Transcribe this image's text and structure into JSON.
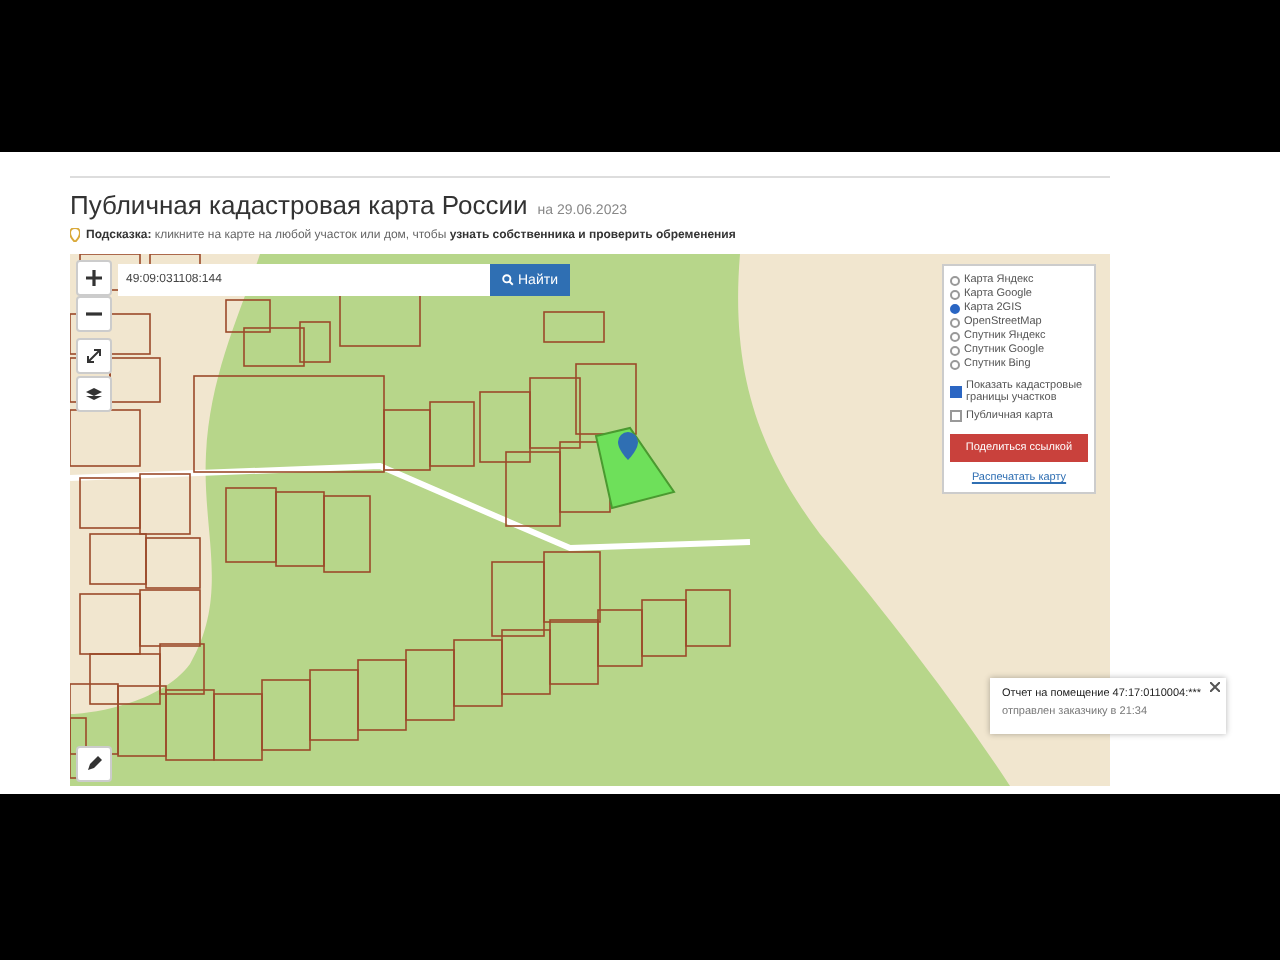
{
  "header": {
    "title": "Публичная кадастровая карта России",
    "date": "на 29.06.2023"
  },
  "hint": "**Подсказка:** кликните на карте на любой участок или дом, чтобы **узнать собственника и проверить обременения**",
  "search": {
    "value": "49:09:031108:144",
    "button": "Найти"
  },
  "layers": [
    {
      "label": "Карта Яндекс",
      "selected": false
    },
    {
      "label": "Карта Google",
      "selected": false
    },
    {
      "label": "Карта 2GIS",
      "selected": true
    },
    {
      "label": "OpenStreetMap",
      "selected": false
    },
    {
      "label": "Спутник Яндекс",
      "selected": false
    },
    {
      "label": "Спутник Google",
      "selected": false
    },
    {
      "label": "Спутник Bing",
      "selected": false
    }
  ],
  "options": [
    {
      "label": "Показать кадастровые границы участков",
      "checked": true
    },
    {
      "label": "Публичная карта",
      "checked": false
    }
  ],
  "share_button": "Поделиться ссылкой",
  "print_link": "Распечатать карту",
  "notification": {
    "title": "Отчет на помещение 47:17:0110004:***",
    "subtitle": "отправлен заказчику в 21:34"
  }
}
